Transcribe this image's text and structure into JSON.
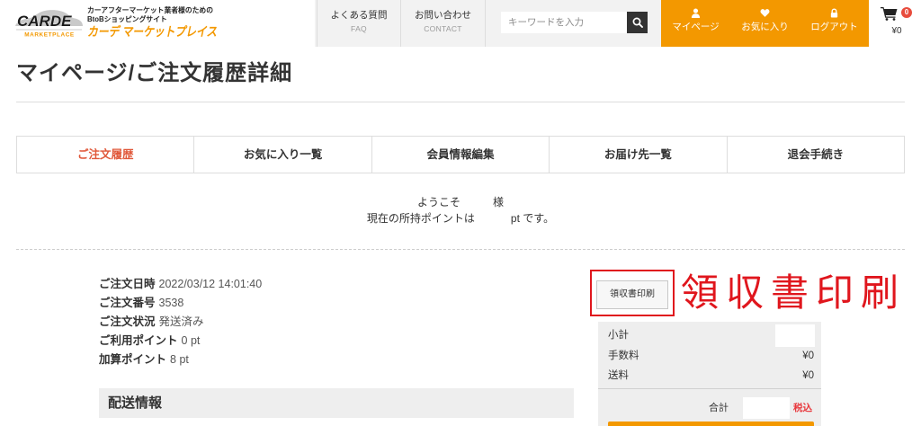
{
  "header": {
    "logo": {
      "brand": "CARDE",
      "sub": "MARKETPLACE"
    },
    "tagline_1": "カーアフターマーケット業者様のための",
    "tagline_2": "BtoBショッピングサイト",
    "site_name": "カーデ マーケットプレイス",
    "nav": [
      {
        "label": "よくある質問",
        "sub": "FAQ"
      },
      {
        "label": "お問い合わせ",
        "sub": "CONTACT"
      }
    ],
    "search": {
      "placeholder": "キーワードを入力",
      "button_icon": "search-icon"
    },
    "user_menu": [
      {
        "label": "マイページ",
        "icon": "person-icon"
      },
      {
        "label": "お気に入り",
        "icon": "heart-icon"
      },
      {
        "label": "ログアウト",
        "icon": "lock-icon"
      }
    ],
    "cart": {
      "icon": "cart-icon",
      "count": "0",
      "total": "¥0"
    }
  },
  "page_title": "マイページ/ご注文履歴詳細",
  "tabs": [
    {
      "label": "ご注文履歴",
      "active": true
    },
    {
      "label": "お気に入り一覧",
      "active": false
    },
    {
      "label": "会員情報編集",
      "active": false
    },
    {
      "label": "お届け先一覧",
      "active": false
    },
    {
      "label": "退会手続き",
      "active": false
    }
  ],
  "welcome": {
    "greeting_prefix": "ようこそ",
    "greeting_suffix": "様",
    "points_prefix": "現在の所持ポイントは",
    "points_suffix": "pt です。"
  },
  "order": {
    "fields": [
      {
        "label": "ご注文日時",
        "value": "2022/03/12 14:01:40"
      },
      {
        "label": "ご注文番号",
        "value": "3538"
      },
      {
        "label": "ご注文状況",
        "value": "発送済み"
      },
      {
        "label": "ご利用ポイント",
        "value": "0 pt"
      },
      {
        "label": "加算ポイント",
        "value": "8 pt"
      }
    ],
    "shipping_heading": "配送情報"
  },
  "receipt": {
    "button_label": "領収書印刷"
  },
  "annotation": {
    "text": "領収書印刷"
  },
  "summary": {
    "subtotal_label": "小計",
    "fee_label": "手数料",
    "fee_value": "¥0",
    "shipping_label": "送料",
    "shipping_value": "¥0",
    "total_label": "合計",
    "tax_note": "税込"
  },
  "colors": {
    "brand_orange": "#f39800",
    "active_tab": "#e0583a",
    "annotation_red": "#e0161d",
    "tax_red": "#e8383d",
    "cart_badge": "#e84c3d"
  }
}
